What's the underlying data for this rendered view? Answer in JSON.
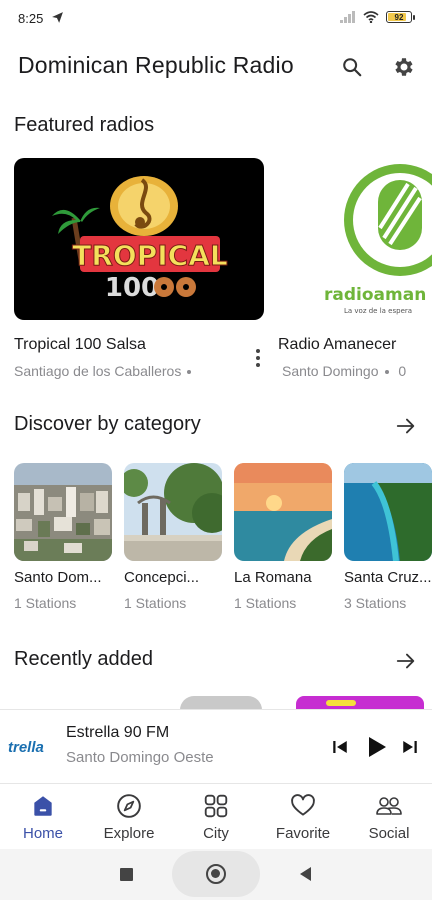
{
  "status_bar": {
    "time": "8:25",
    "battery": "92",
    "battery_level": 0.92
  },
  "app_bar": {
    "title": "Dominican Republic Radio",
    "search_icon": "search-icon",
    "settings_icon": "gear-icon"
  },
  "featured": {
    "title": "Featured radios",
    "items": [
      {
        "name": "Tropical 100 Salsa",
        "location": "Santiago de los Caballeros",
        "logo_text": "TROPICAL",
        "logo_sub": "100"
      },
      {
        "name": "Radio Amanecer",
        "location": "Santo Domingo",
        "logo_text": "radioaman",
        "logo_sub": "La voz de la espera"
      }
    ]
  },
  "categories": {
    "title": "Discover by category",
    "items": [
      {
        "name": "Santo Dom...",
        "count": "1 Stations"
      },
      {
        "name": "Concepci...",
        "count": "1 Stations"
      },
      {
        "name": "La Romana",
        "count": "1 Stations"
      },
      {
        "name": "Santa Cruz...",
        "count": "3 Stations"
      }
    ]
  },
  "recent": {
    "title": "Recently added"
  },
  "player": {
    "logo": "trella",
    "title": "Estrella 90 FM",
    "subtitle": "Santo Domingo Oeste"
  },
  "nav": {
    "items": [
      {
        "label": "Home",
        "icon": "home-icon",
        "active": true
      },
      {
        "label": "Explore",
        "icon": "compass-icon",
        "active": false
      },
      {
        "label": "City",
        "icon": "grid-icon",
        "active": false
      },
      {
        "label": "Favorite",
        "icon": "heart-icon",
        "active": false
      },
      {
        "label": "Social",
        "icon": "people-icon",
        "active": false
      }
    ]
  },
  "colors": {
    "accent": "#3b51a8",
    "muted": "#8a8a8e",
    "text": "#1c1c1e"
  }
}
